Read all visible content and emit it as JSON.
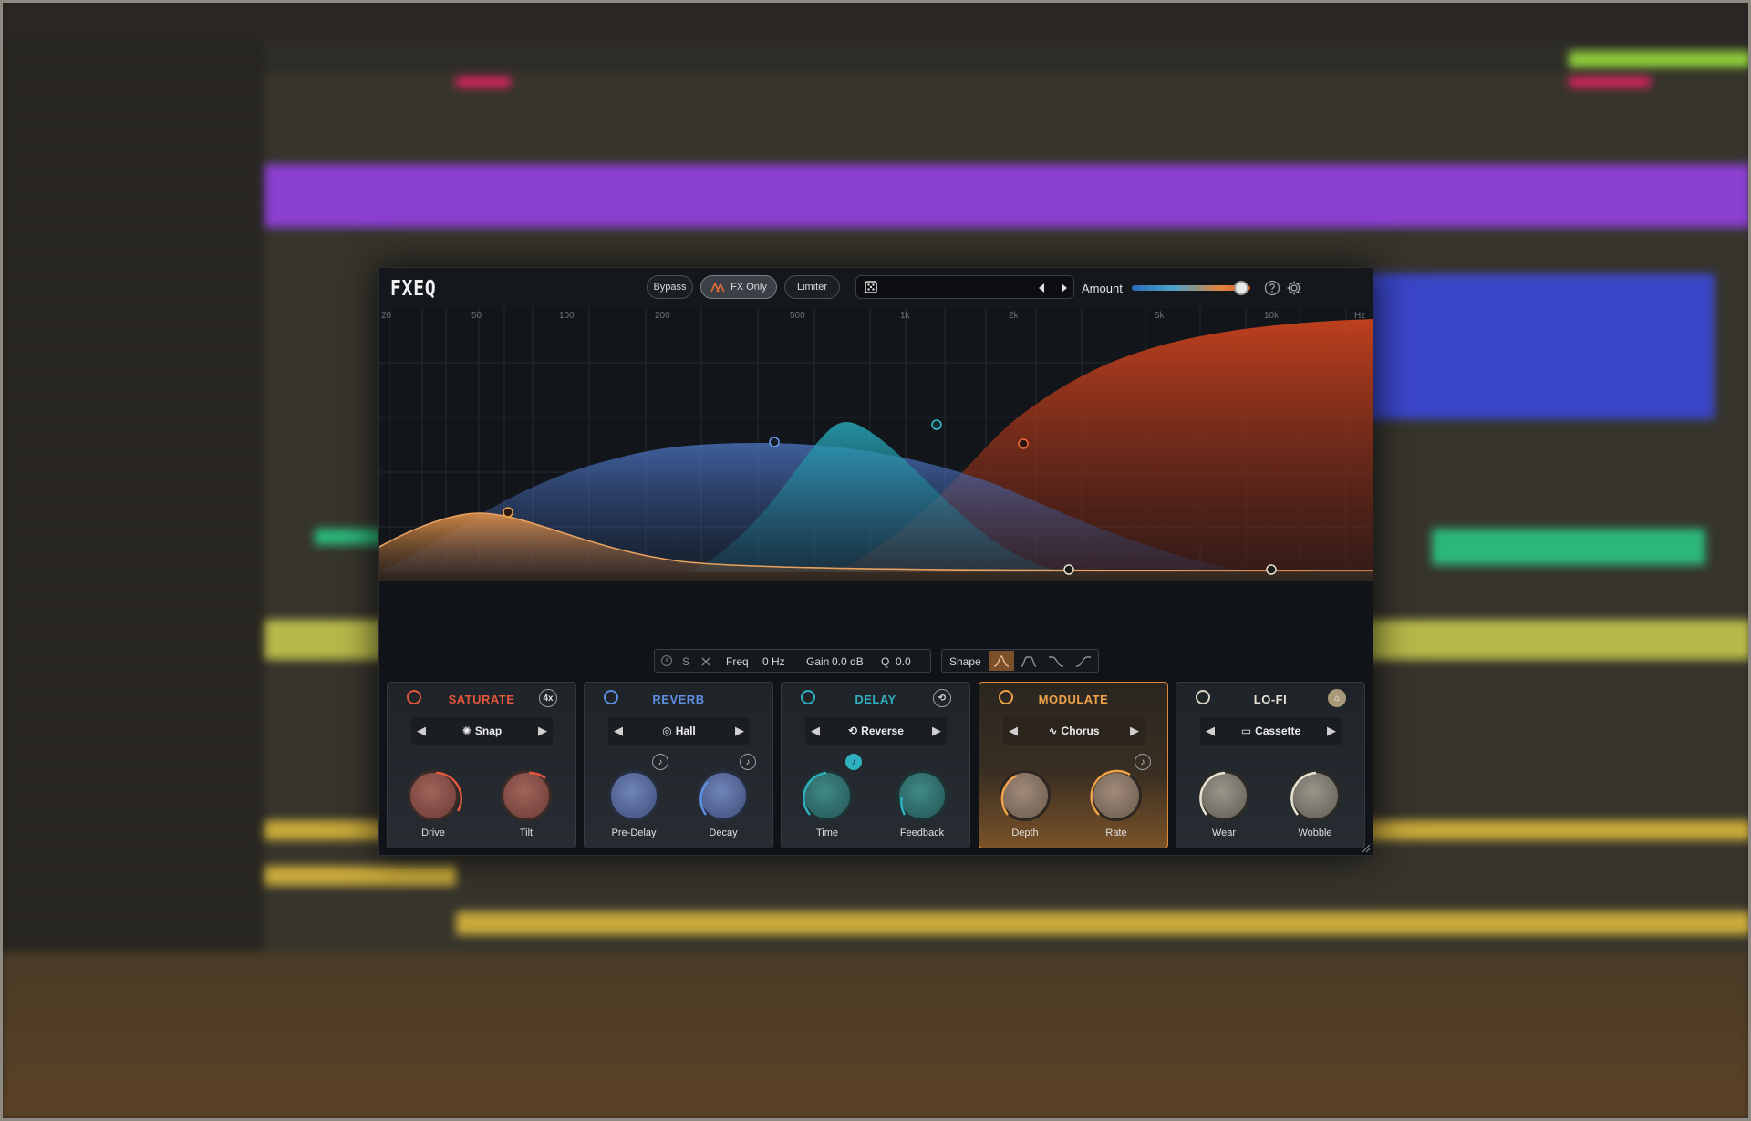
{
  "plugin": {
    "title": "FXEQ",
    "toolbar": {
      "bypass_label": "Bypass",
      "fx_only_label": "FX Only",
      "limiter_label": "Limiter",
      "amount_label": "Amount",
      "amount_value": 0.92
    },
    "graph": {
      "freq_labels": [
        "20",
        "50",
        "100",
        "200",
        "500",
        "1k",
        "2k",
        "5k",
        "10k",
        "Hz"
      ]
    },
    "band_control": {
      "solo": "S",
      "freq_label": "Freq",
      "freq_value": "0 Hz",
      "gain_label": "Gain",
      "gain_value": "0.0 dB",
      "q_label": "Q",
      "q_value": "0.0",
      "shape_label": "Shape"
    },
    "modules": [
      {
        "title": "SATURATE",
        "color": "#e2563a",
        "badge": "4x",
        "selection": "Snap",
        "knobs": [
          "Drive",
          "Tilt"
        ]
      },
      {
        "title": "REVERB",
        "color": "#5d8ee0",
        "selection": "Hall",
        "knobs": [
          "Pre-Delay",
          "Decay"
        ]
      },
      {
        "title": "DELAY",
        "color": "#2fb0c0",
        "selection": "Reverse",
        "knobs": [
          "Time",
          "Feedback"
        ]
      },
      {
        "title": "MODULATE",
        "color": "#f0a24a",
        "selection": "Chorus",
        "knobs": [
          "Depth",
          "Rate"
        ]
      },
      {
        "title": "LO-FI",
        "color": "#d9d3c2",
        "selection": "Cassette",
        "knobs": [
          "Wear",
          "Wobble"
        ]
      }
    ]
  },
  "colors": {
    "saturate": "#e2563a",
    "reverb": "#5d8ee0",
    "delay": "#2fb0c0",
    "modulate": "#f0a24a",
    "lofi": "#d9d3c2"
  }
}
